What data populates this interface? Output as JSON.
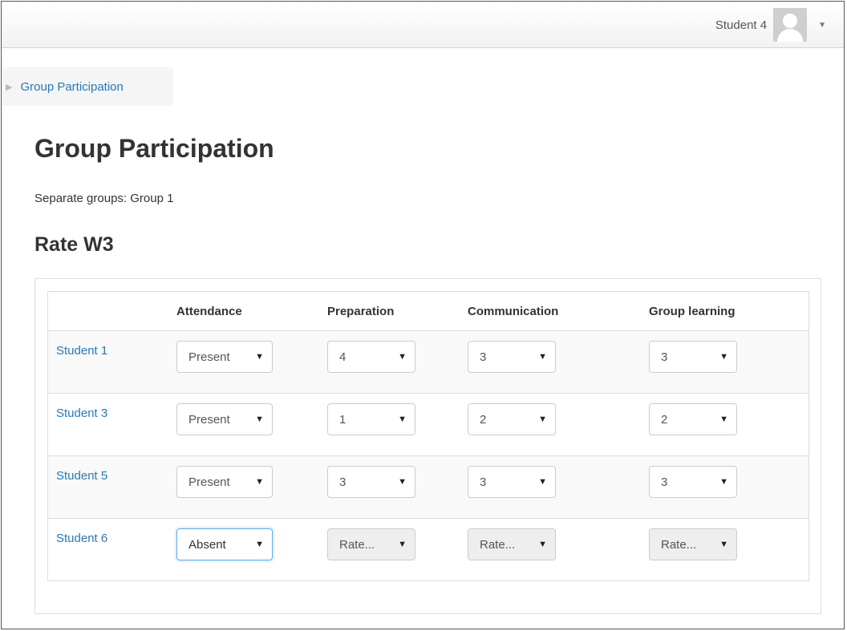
{
  "header": {
    "user_name": "Student 4",
    "caret": "▼"
  },
  "breadcrumb": {
    "arrow": "▶",
    "label": "Group Participation"
  },
  "page": {
    "title": "Group Participation",
    "group_text": "Separate groups: Group 1",
    "subtitle": "Rate W3"
  },
  "table": {
    "columns": [
      "",
      "Attendance",
      "Preparation",
      "Communication",
      "Group learning"
    ],
    "rows": [
      {
        "student": "Student 1",
        "attendance": "Present",
        "preparation": "4",
        "communication": "3",
        "group_learning": "3",
        "disabled": false
      },
      {
        "student": "Student 3",
        "attendance": "Present",
        "preparation": "1",
        "communication": "2",
        "group_learning": "2",
        "disabled": false
      },
      {
        "student": "Student 5",
        "attendance": "Present",
        "preparation": "3",
        "communication": "3",
        "group_learning": "3",
        "disabled": false
      },
      {
        "student": "Student 6",
        "attendance": "Absent",
        "preparation": "Rate...",
        "communication": "Rate...",
        "group_learning": "Rate...",
        "disabled": true
      }
    ]
  },
  "select_arrow": "▼",
  "colors": {
    "link": "#2a78b4",
    "focus_border": "#66afe9",
    "disabled_bg": "#eeeeee"
  }
}
